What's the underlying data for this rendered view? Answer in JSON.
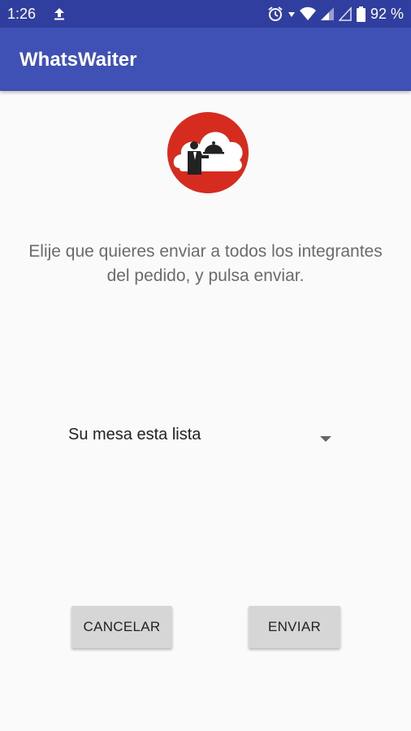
{
  "status_bar": {
    "time": "1:26",
    "battery": "92 %",
    "icons": [
      "upload-icon",
      "alarm-icon",
      "wifi-icon",
      "signal-icon",
      "signal-empty-icon",
      "battery-icon"
    ]
  },
  "app_bar": {
    "title": "WhatsWaiter"
  },
  "logo": {
    "icon": "waiter-cloud-logo",
    "colors": {
      "ring": "#d62b1f",
      "inner": "#ffffff",
      "figure": "#222222"
    }
  },
  "instructions": "Elije que quieres enviar a todos los integrantes del pedido, y pulsa enviar.",
  "message_select": {
    "selected": "Su mesa esta lista"
  },
  "buttons": {
    "cancel": "CANCELAR",
    "send": "ENVIAR"
  },
  "colors": {
    "status_bar": "#303f9f",
    "app_bar": "#3f51b5",
    "background": "#fafafa",
    "button": "#d6d6d6"
  }
}
